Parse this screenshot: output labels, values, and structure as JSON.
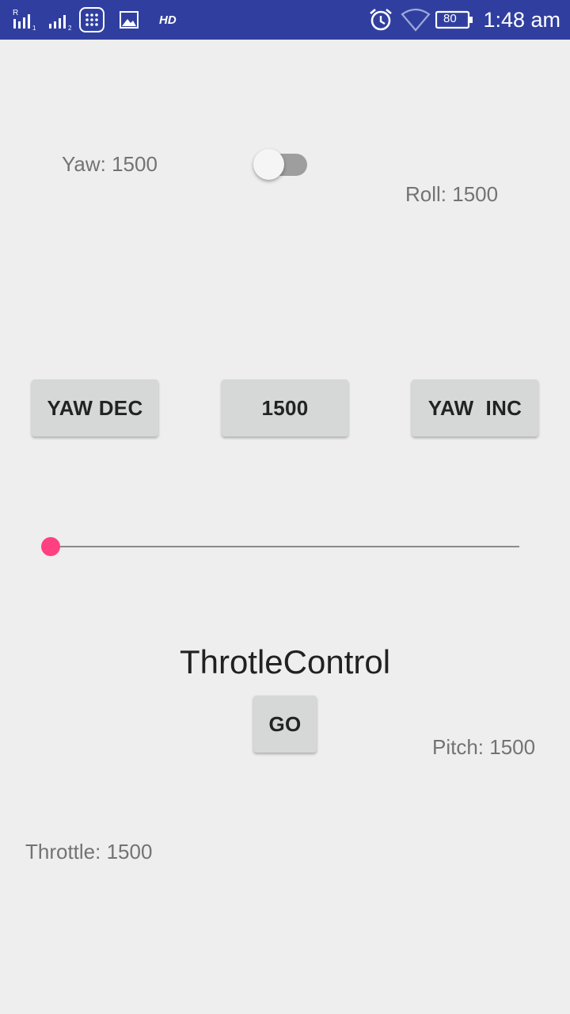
{
  "status_bar": {
    "time": "1:48 am",
    "battery": "80",
    "hd": "HD",
    "icons": [
      "signal-r1-icon",
      "signal-2-icon",
      "keypad-app-icon",
      "gallery-icon",
      "hd-icon",
      "alarm-icon",
      "wifi-icon",
      "battery-icon"
    ]
  },
  "labels": {
    "yaw": "Yaw: 1500",
    "roll": "Roll: 1500",
    "pitch": "Pitch: 1500",
    "throttle": "Throttle: 1500",
    "title": "ThrotleControl"
  },
  "switch": {
    "on": false
  },
  "buttons": {
    "yaw_dec": "YAW DEC",
    "center": "1500",
    "yaw_inc": "YAW  INC",
    "go": "GO"
  },
  "seekbar": {
    "progress_percent": 0,
    "accent": "#ff4081"
  },
  "colors": {
    "status_bar": "#303f9f",
    "background": "#eeeeee",
    "accent": "#ff4081"
  }
}
